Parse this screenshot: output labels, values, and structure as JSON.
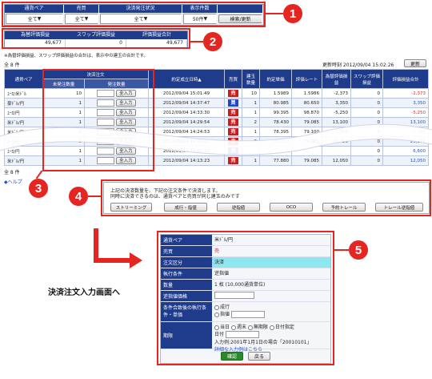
{
  "filters": {
    "headers": [
      "通貨ペア",
      "売買",
      "決済発注状況",
      "表示件数"
    ],
    "values": [
      "全て",
      "全て",
      "全て",
      "50件"
    ],
    "search_label": "検索/更新"
  },
  "pl_summary": {
    "headers": [
      "為替評価損益",
      "スワップ評価損益",
      "評価損益合計"
    ],
    "values": [
      "49,677",
      "0",
      "49,677"
    ],
    "note": "※為替評価損益、スワップ評価損益の合計は、表示中の建玉の合計です。"
  },
  "count_top": "全 8 件",
  "count_bottom": "全 8 件",
  "updated_text": "更新時刻 2012/09/04 15:02:26",
  "refresh_label": "更新",
  "help_link": "ヘルプ",
  "table": {
    "headers": {
      "pair": "通貨ペア",
      "settle": "決済注文",
      "unordered": "未発注数量",
      "order_qty": "発注数量",
      "date": "約定成立日時▲",
      "side": "売買",
      "pos_qty": "建玉数量",
      "price": "約定単価",
      "rate": "評価レート",
      "fx_pl": "為替評価損益",
      "swap_pl": "スワップ評価損益",
      "total_pl": "評価損益合計"
    },
    "all_in_label": "全入力",
    "rows": [
      {
        "pair": "ﾕｰﾛ/米ﾄﾞﾙ",
        "unordered": "10",
        "date": "2012/09/04 15:01:49",
        "side": "売",
        "qty": "10",
        "price": "1.5989",
        "rate": "1.5986",
        "fx": "-2,373",
        "swap": "0",
        "total": "-2,373",
        "tone": "neg"
      },
      {
        "pair": "豪ﾄﾞﾙ/円",
        "unordered": "1",
        "date": "2012/09/04 14:37:47",
        "side": "買",
        "qty": "1",
        "price": "80.985",
        "rate": "80.650",
        "fx": "3,350",
        "swap": "0",
        "total": "3,350",
        "tone": "pos"
      },
      {
        "pair": "ﾕｰﾛ/円",
        "unordered": "1",
        "date": "2012/09/04 14:33:30",
        "side": "売",
        "qty": "1",
        "price": "99.395",
        "rate": "98.870",
        "fx": "-5,250",
        "swap": "0",
        "total": "-5,250",
        "tone": "neg"
      },
      {
        "pair": "米ﾄﾞﾙ/円",
        "unordered": "1",
        "date": "2012/09/04 14:29:54",
        "side": "売",
        "qty": "2",
        "price": "78.430",
        "rate": "79.085",
        "fx": "13,100",
        "swap": "0",
        "total": "13,100",
        "tone": "pos"
      },
      {
        "pair": "米ﾄﾞﾙ/円",
        "unordered": "1",
        "date": "2012/09/04 14:24:53",
        "side": "売",
        "qty": "1",
        "price": "78.395",
        "rate": "79.100",
        "fx": "-7,050",
        "swap": "0",
        "total": "-7,050",
        "tone": "neg"
      },
      {
        "pair": "ﾕｰﾛ/円",
        "unordered": "3",
        "date": "2012/09/04 14:20:17",
        "side": "売",
        "qty": "3",
        "price": "78.110",
        "rate": "79.085",
        "fx": "29,250",
        "swap": "0",
        "total": "29,250",
        "tone": "pos"
      },
      {
        "pair": "ﾕｰﾛ/円",
        "unordered": "1",
        "date": "2012/09/04 14:15:22",
        "side": "買",
        "qty": "",
        "price": "",
        "rate": "",
        "fx": "",
        "swap": "0",
        "total": "6,600",
        "tone": "pos"
      },
      {
        "pair": "米ﾄﾞﾙ/円",
        "unordered": "1",
        "date": "2012/09/04 14:13:23",
        "side": "売",
        "qty": "1",
        "price": "77.880",
        "rate": "79.085",
        "fx": "12,050",
        "swap": "0",
        "total": "12,050",
        "tone": "pos"
      }
    ]
  },
  "order_panel": {
    "line1": "上記の決済数量を、下記の注文条件で決済します。",
    "line2": "同時に決済できるのは、通貨ペアと売買が同じ建玉のみです",
    "buttons": [
      "ストリーミング",
      "成行・指値",
      "逆指値",
      "OCO",
      "予約トレール",
      "トレール逆指値"
    ]
  },
  "arrow_label": "決済注文入力画面へ",
  "form": {
    "rows": [
      {
        "label": "通貨ペア",
        "value": "米ﾄﾞﾙ/円"
      },
      {
        "label": "売買",
        "value": "売"
      },
      {
        "label": "注文区分",
        "value": "決済"
      },
      {
        "label": "執行条件",
        "value": "逆指値"
      },
      {
        "label": "数量",
        "value": "1 枚 (10,000通貨単位)"
      },
      {
        "label": "逆指値価格",
        "value": ""
      }
    ],
    "cond_label": "条件合致後の執行条件・単価",
    "cond_options": [
      "成行",
      "指値"
    ],
    "period_label": "期限",
    "period_options": [
      "当日",
      "週末",
      "無期限",
      "日付指定"
    ],
    "period_date_label": "日付",
    "period_note1": "入力例:2001年1月1日の場合「20010101」",
    "period_note2": "詳細な入力例はこちら",
    "confirm_label": "確認",
    "back_label": "戻る"
  },
  "badges": [
    "1",
    "2",
    "3",
    "4",
    "5"
  ],
  "accent": "#e52521",
  "header_blue": "#1f3c8c"
}
